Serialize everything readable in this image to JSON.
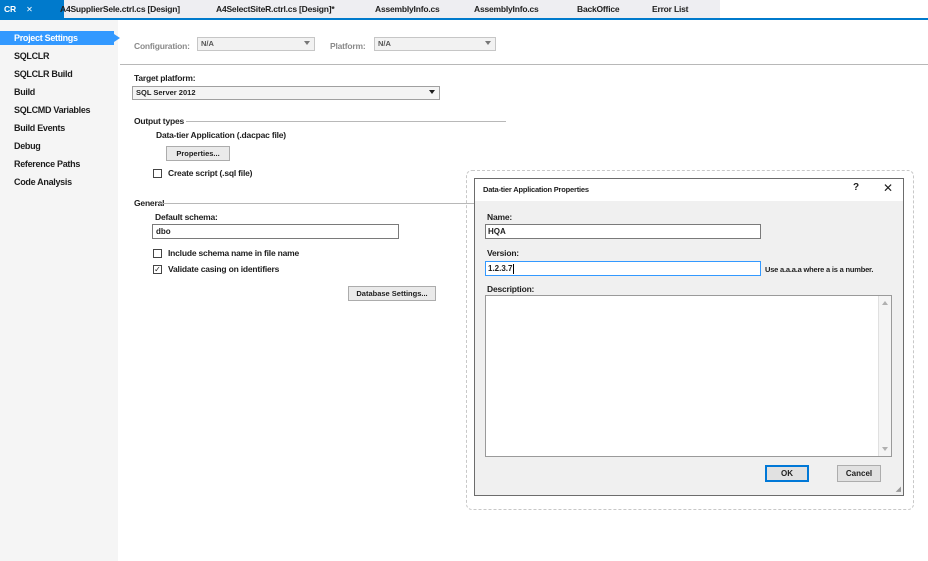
{
  "tabs": {
    "active": {
      "label": "CR",
      "close": "✕"
    },
    "items": [
      "A4SupplierSele.ctrl.cs [Design]",
      "A4SelectSiteR.ctrl.cs [Design]*",
      "AssemblyInfo.cs",
      "AssemblyInfo.cs",
      "BackOffice",
      "Error List"
    ]
  },
  "nav": {
    "items": [
      "Project Settings",
      "SQLCLR",
      "SQLCLR Build",
      "Build",
      "SQLCMD Variables",
      "Build Events",
      "Debug",
      "Reference Paths",
      "Code Analysis"
    ]
  },
  "config": {
    "configuration_label": "Configuration:",
    "configuration_value": "N/A",
    "platform_label": "Platform:",
    "platform_value": "N/A"
  },
  "target": {
    "label": "Target platform:",
    "value": "SQL Server 2012"
  },
  "output": {
    "label": "Output types",
    "dac_label": "Data-tier Application (.dacpac file)",
    "properties_button": "Properties...",
    "create_script_label": "Create script (.sql file)",
    "create_script_checked": false
  },
  "general": {
    "label": "General",
    "default_schema_label": "Default schema:",
    "default_schema_value": "dbo",
    "include_schema_label": "Include schema name in file name",
    "include_schema_checked": false,
    "validate_casing_label": "Validate casing on identifiers",
    "validate_casing_checked": true,
    "db_settings_button": "Database Settings..."
  },
  "dialog": {
    "title": "Data-tier Application Properties",
    "help": "?",
    "close": "✕",
    "name_label": "Name:",
    "name_value": "HQA",
    "version_label": "Version:",
    "version_value": "1.2.3.7",
    "version_hint": "Use a.a.a.a where a is a number.",
    "description_label": "Description:",
    "description_value": "",
    "ok_button": "OK",
    "cancel_button": "Cancel"
  },
  "colors": {
    "accent": "#007acc",
    "nav_selected": "#3399ff"
  }
}
